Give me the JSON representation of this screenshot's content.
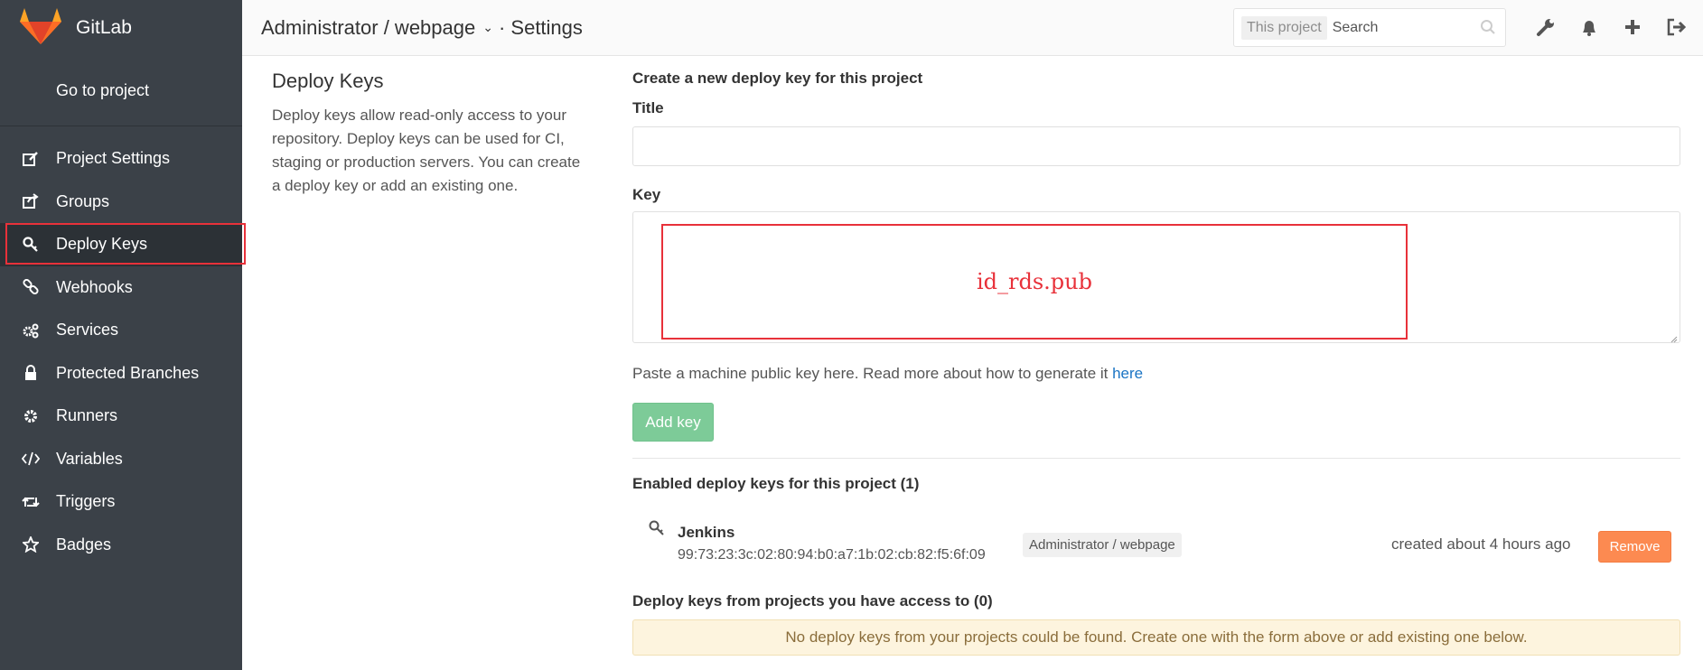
{
  "brand": {
    "name": "GitLab"
  },
  "sidebar": {
    "goto_label": "Go to project",
    "items": [
      {
        "label": "Project Settings",
        "icon": "edit-icon"
      },
      {
        "label": "Groups",
        "icon": "share-icon"
      },
      {
        "label": "Deploy Keys",
        "icon": "key-icon",
        "active": true
      },
      {
        "label": "Webhooks",
        "icon": "link-icon"
      },
      {
        "label": "Services",
        "icon": "cogs-icon"
      },
      {
        "label": "Protected Branches",
        "icon": "lock-icon"
      },
      {
        "label": "Runners",
        "icon": "cog-icon"
      },
      {
        "label": "Variables",
        "icon": "code-icon"
      },
      {
        "label": "Triggers",
        "icon": "retweet-icon"
      },
      {
        "label": "Badges",
        "icon": "star-icon"
      }
    ]
  },
  "header": {
    "breadcrumb": "Administrator / webpage",
    "section": "· Settings",
    "search_scope": "This project",
    "search_placeholder": "Search",
    "icons": [
      "wrench-icon",
      "bell-icon",
      "plus-icon",
      "sign-out-icon"
    ]
  },
  "intro": {
    "title": "Deploy Keys",
    "description": "Deploy keys allow read-only access to your repository. Deploy keys can be used for CI, staging or production servers. You can create a deploy key or add an existing one."
  },
  "form": {
    "heading": "Create a new deploy key for this project",
    "title_label": "Title",
    "title_value": "",
    "key_label": "Key",
    "key_annotation": "id_rds.pub",
    "hint_text": "Paste a machine public key here. Read more about how to generate it ",
    "hint_link": "here",
    "submit_label": "Add key"
  },
  "enabled": {
    "heading": "Enabled deploy keys for this project (1)",
    "keys": [
      {
        "name": "Jenkins",
        "fingerprint": "99:73:23:3c:02:80:94:b0:a7:1b:02:cb:82:f5:6f:09",
        "project": "Administrator / webpage",
        "created": "created about 4 hours ago",
        "action": "Remove"
      }
    ]
  },
  "accessible": {
    "heading": "Deploy keys from projects you have access to (0)",
    "empty_message": "No deploy keys from your projects could be found. Create one with the form above or add existing one below."
  },
  "colors": {
    "sidebar_bg": "#3b4148",
    "highlight": "#e8313a",
    "success_btn": "#7dcb98",
    "remove_btn": "#fc8a51",
    "link": "#1a74c4"
  }
}
